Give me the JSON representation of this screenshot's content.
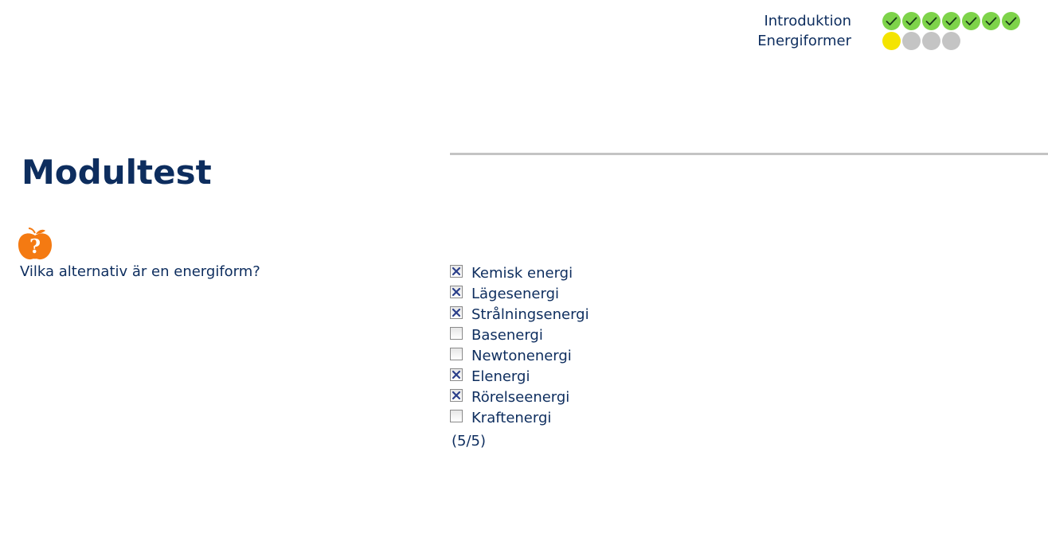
{
  "progress": {
    "rows": [
      {
        "label": "Introduktion",
        "steps": [
          "done",
          "done",
          "done",
          "done",
          "done",
          "done",
          "done"
        ]
      },
      {
        "label": "Energiformer",
        "steps": [
          "current",
          "todo",
          "todo",
          "todo"
        ]
      }
    ]
  },
  "page": {
    "title": "Modultest"
  },
  "question": {
    "icon": "apple-question-icon",
    "text": "Vilka alternativ är en energiform?",
    "options": [
      {
        "label": "Kemisk energi",
        "checked": true
      },
      {
        "label": "Lägesenergi",
        "checked": true
      },
      {
        "label": "Strålningsenergi",
        "checked": true
      },
      {
        "label": "Basenergi",
        "checked": false
      },
      {
        "label": "Newtonenergi",
        "checked": false
      },
      {
        "label": "Elenergi",
        "checked": true
      },
      {
        "label": "Rörelseenergi",
        "checked": true
      },
      {
        "label": "Kraftenergi",
        "checked": false
      }
    ],
    "score": "(5/5)"
  },
  "colors": {
    "text": "#0d2d5e",
    "done": "#7ed34a",
    "current": "#f4e400",
    "todo": "#c4c4c4",
    "apple": "#f47a12"
  }
}
